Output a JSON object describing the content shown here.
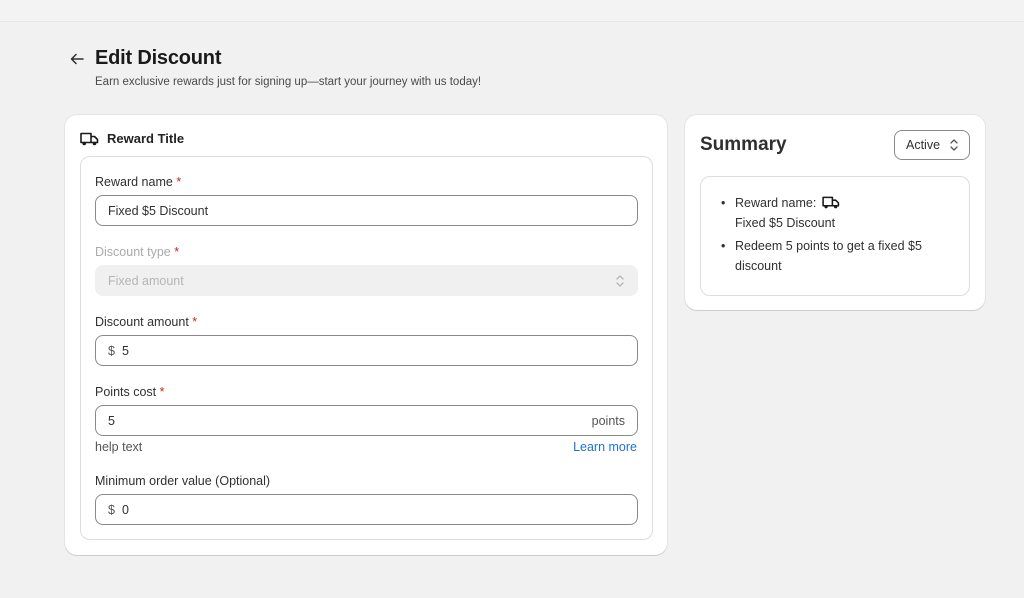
{
  "header": {
    "title": "Edit Discount",
    "subtitle": "Earn exclusive rewards just for signing up—start your journey with us today!"
  },
  "reward_card": {
    "title": "Reward Title",
    "icon": "truck-icon",
    "required_mark": "*",
    "reward_name": {
      "label": "Reward name",
      "value": "Fixed $5 Discount"
    },
    "discount_type": {
      "label": "Discount type",
      "value": "Fixed amount"
    },
    "discount_amount": {
      "label": "Discount amount",
      "prefix": "$",
      "value": "5"
    },
    "points_cost": {
      "label": "Points cost",
      "value": "5",
      "suffix": "points",
      "help": "help text",
      "link": "Learn more"
    },
    "min_order": {
      "label": "Minimum order value (Optional)",
      "prefix": "$",
      "value": "0"
    }
  },
  "summary": {
    "title": "Summary",
    "status": "Active",
    "items": [
      {
        "label": "Reward name:",
        "value": "Fixed $5 Discount"
      },
      {
        "text": "Redeem 5 points to get a fixed $5 discount"
      }
    ]
  },
  "colors": {
    "background": "#f1f1f1",
    "link": "#1f6fd1",
    "required": "#c5281c"
  }
}
